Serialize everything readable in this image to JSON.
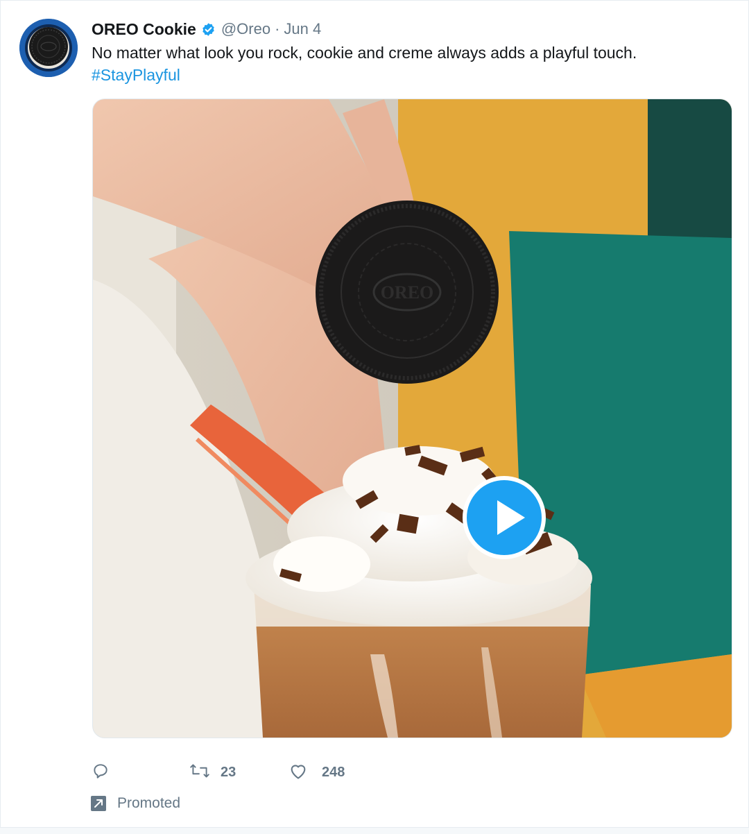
{
  "tweet": {
    "author_name": "OREO Cookie",
    "handle": "@Oreo",
    "separator": "·",
    "date": "Jun 4",
    "text_line1": "No matter what look you rock, cookie and creme always adds a playful touch.",
    "hashtag": "#StayPlayful"
  },
  "media": {
    "type": "video",
    "play_icon": "play-icon",
    "cookie_text": "OREO"
  },
  "actions": {
    "reply_icon": "reply-icon",
    "retweet_icon": "retweet-icon",
    "retweet_count": "23",
    "like_icon": "heart-icon",
    "like_count": "248"
  },
  "promoted": {
    "icon": "promoted-arrow-icon",
    "label": "Promoted"
  },
  "colors": {
    "link": "#1b95e0",
    "verified": "#1da1f2",
    "muted": "#657786",
    "play_button": "#1da1f2",
    "avatar_ring": "#1d5fb0"
  }
}
